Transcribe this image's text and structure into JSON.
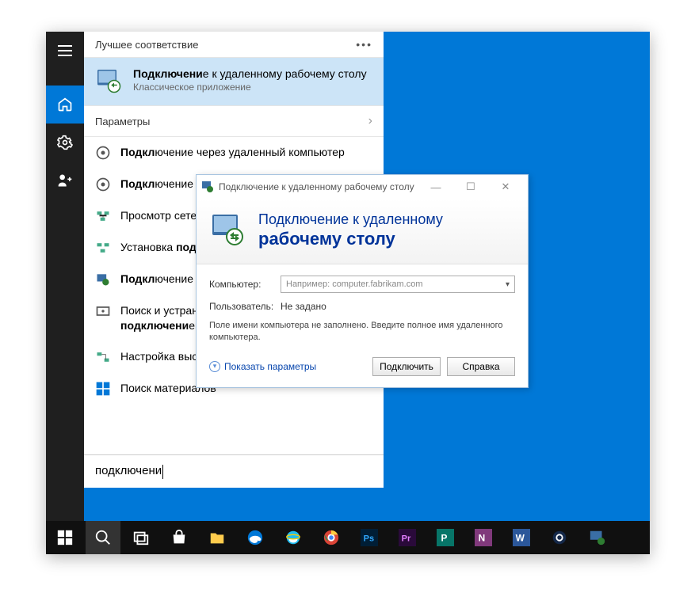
{
  "start": {
    "best_match_header": "Лучшее соответствие",
    "best_match": {
      "title_html": "<b>Подключени</b>е к удаленному рабочему столу",
      "subtitle": "Классическое приложение"
    },
    "params_header": "Параметры",
    "results": [
      "<b>Подкл</b>ючение через удаленный компьютер",
      "<b>Подкл</b>ючение через доменную сеть",
      "Просмотр сетевых <b>подключени</b>й",
      "Установка <b>подключени</b>я",
      "<b>Подкл</b>ючение к удаленному рабочему столу с ...",
      "Поиск и устранение проблем с сетью и <b>подключени</b>ем",
      "Настройка высокоскоростного <b>подключени</b>я",
      "Поиск материалов"
    ],
    "search_value": "подключени"
  },
  "rdp": {
    "title": "Подключение к удаленному рабочему столу",
    "banner_line1": "Подключение к удаленному",
    "banner_line2": "рабочему столу",
    "computer_label": "Компьютер:",
    "computer_placeholder": "Например: computer.fabrikam.com",
    "user_label": "Пользователь:",
    "user_value": "Не задано",
    "hint": "Поле имени компьютера не заполнено. Введите полное имя удаленного компьютера.",
    "show_params": "Показать параметры",
    "connect_btn": "Подключить",
    "help_btn": "Справка"
  },
  "taskbar": {
    "items": [
      "start",
      "search",
      "taskview",
      "store",
      "explorer",
      "edge",
      "ie",
      "chrome",
      "photoshop",
      "premiere",
      "publisher",
      "onenote",
      "word",
      "steam",
      "rdp"
    ]
  }
}
